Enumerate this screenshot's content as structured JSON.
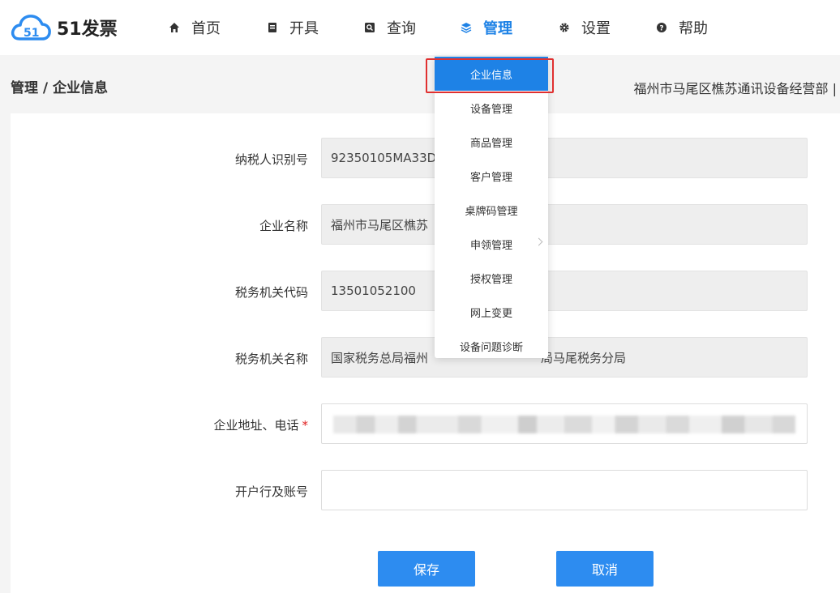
{
  "brand": {
    "name": "51发票",
    "accent": "#1e82e6",
    "logo_icon": "cloud-51-logo"
  },
  "nav": {
    "items": [
      {
        "label": "首页",
        "icon": "home-icon"
      },
      {
        "label": "开具",
        "icon": "invoice-icon"
      },
      {
        "label": "查询",
        "icon": "search-icon"
      },
      {
        "label": "管理",
        "icon": "layers-icon",
        "active": true
      },
      {
        "label": "设置",
        "icon": "gear-icon"
      },
      {
        "label": "帮助",
        "icon": "help-icon"
      }
    ]
  },
  "breadcrumb": {
    "parent": "管理",
    "separator": " / ",
    "current": "企业信息",
    "text": "管理 / 企业信息"
  },
  "header_right": {
    "company": "福州市马尾区樵苏通讯设备经营部 |"
  },
  "dropdown": {
    "items": [
      {
        "label": "企业信息",
        "selected": true
      },
      {
        "label": "设备管理"
      },
      {
        "label": "商品管理"
      },
      {
        "label": "客户管理"
      },
      {
        "label": "桌牌码管理"
      },
      {
        "label": "申领管理",
        "has_submenu": true
      },
      {
        "label": "授权管理"
      },
      {
        "label": "网上变更"
      },
      {
        "label": "设备问题诊断"
      }
    ]
  },
  "form": {
    "fields": [
      {
        "label": "纳税人识别号",
        "value": "92350105MA33D7",
        "readonly": true
      },
      {
        "label": "企业名称",
        "value": "福州市马尾区樵苏",
        "readonly": true
      },
      {
        "label": "税务机关代码",
        "value": "13501052100",
        "readonly": true
      },
      {
        "label": "税务机关名称",
        "value": "国家税务总局福州",
        "value_tail": "局马尾税务分局",
        "readonly": true
      },
      {
        "label": "企业地址、电话",
        "required_mark": "*",
        "value": "",
        "readonly": false,
        "blurred": true
      },
      {
        "label": "开户行及账号",
        "value": "",
        "readonly": false
      }
    ]
  },
  "buttons": {
    "save": "保存",
    "cancel": "取消"
  }
}
